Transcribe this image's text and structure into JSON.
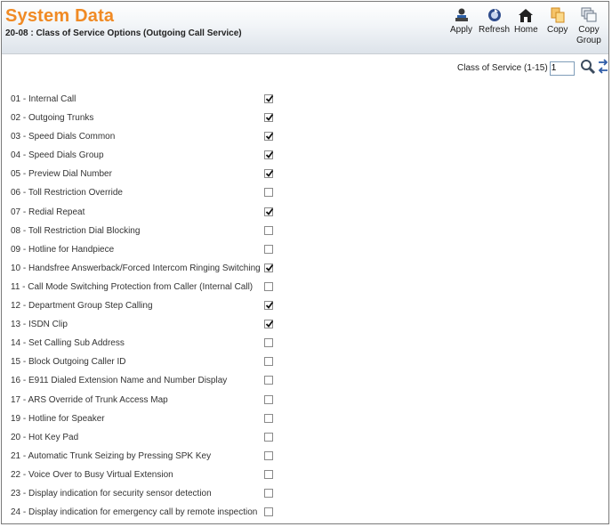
{
  "header": {
    "title": "System Data",
    "subtitle": "20-08 : Class of Service Options (Outgoing Call Service)"
  },
  "toolbar": {
    "apply": "Apply",
    "refresh": "Refresh",
    "home": "Home",
    "copy": "Copy",
    "copy_group_line1": "Copy",
    "copy_group_line2": "Group"
  },
  "class_of_service": {
    "label": "Class of Service (1-15)",
    "value": "1"
  },
  "options": [
    {
      "label": "01 - Internal Call",
      "checked": true
    },
    {
      "label": "02 - Outgoing Trunks",
      "checked": true
    },
    {
      "label": "03 - Speed Dials Common",
      "checked": true
    },
    {
      "label": "04 - Speed Dials Group",
      "checked": true
    },
    {
      "label": "05 - Preview Dial Number",
      "checked": true
    },
    {
      "label": "06 - Toll Restriction Override",
      "checked": false
    },
    {
      "label": "07 - Redial Repeat",
      "checked": true
    },
    {
      "label": "08 - Toll Restriction Dial Blocking",
      "checked": false
    },
    {
      "label": "09 - Hotline for Handpiece",
      "checked": false
    },
    {
      "label": "10 - Handsfree Answerback/Forced Intercom Ringing Switching",
      "checked": true
    },
    {
      "label": "11 - Call Mode Switching Protection from Caller (Internal Call)",
      "checked": false
    },
    {
      "label": "12 - Department Group Step Calling",
      "checked": true
    },
    {
      "label": "13 - ISDN Clip",
      "checked": true
    },
    {
      "label": "14 - Set Calling Sub Address",
      "checked": false
    },
    {
      "label": "15 - Block Outgoing Caller ID",
      "checked": false
    },
    {
      "label": "16 - E911 Dialed Extension Name and Number Display",
      "checked": false
    },
    {
      "label": "17 - ARS Override of Trunk Access Map",
      "checked": false
    },
    {
      "label": "19 - Hotline for Speaker",
      "checked": false
    },
    {
      "label": "20 - Hot Key Pad",
      "checked": false
    },
    {
      "label": "21 - Automatic Trunk Seizing by Pressing SPK Key",
      "checked": false
    },
    {
      "label": "22 - Voice Over to Busy Virtual Extension",
      "checked": false
    },
    {
      "label": "23 - Display indication for security sensor detection",
      "checked": false
    },
    {
      "label": "24 - Display indication for emergency call by remote inspection",
      "checked": false
    }
  ]
}
